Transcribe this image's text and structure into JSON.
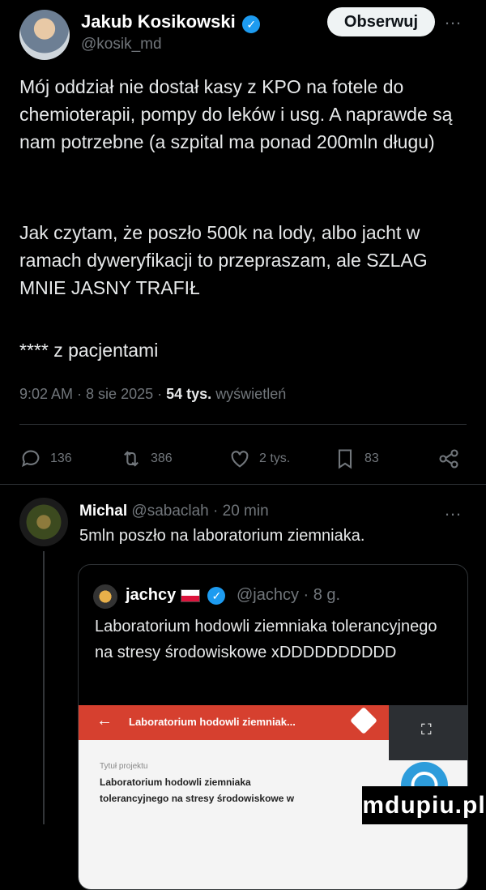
{
  "post": {
    "author_name": "Jakub Kosikowski",
    "author_handle": "@kosik_md",
    "follow_label": "Obserwuj",
    "more_icon": "…",
    "paragraphs": [
      "Mój oddział nie dostał kasy z KPO na fotele do chemioterapii, pompy do leków i usg. A naprawde są nam potrzebne (a szpital ma ponad 200mln długu)",
      "Jak czytam, że poszło 500k na lody, albo jacht w ramach dyweryfikacji to przepraszam, ale SZLAG MNIE JASNY TRAFIŁ",
      "**** z pacjentami"
    ],
    "time": "9:02 AM",
    "date": "8 sie 2025",
    "views_count": "54 tys.",
    "views_label": "wyświetleń"
  },
  "actions": {
    "replies": "136",
    "reposts": "386",
    "likes": "2 tys.",
    "bookmarks": "83"
  },
  "reply": {
    "author_name": "Michal",
    "author_handle": "@sabaclah",
    "age": "20 min",
    "text": "5mln poszło na laboratorium ziemniaka."
  },
  "quote": {
    "author_name": "jachcy",
    "author_handle": "@jachcy",
    "age": "8 g.",
    "text": "Laboratorium hodowli ziemniaka tolerancyjnego na stresy środowiskowe xDDDDDDDDDD",
    "image": {
      "header_title": "Laboratorium hodowli ziemniak...",
      "field_label": "Tytuł projektu",
      "field_value_line1": "Laboratorium hodowli ziemniaka",
      "field_value_line2": "tolerancyjnego na stresy środowiskowe w"
    }
  },
  "watermark": "mdupiu.pl",
  "colors": {
    "accent": "#1d9bf0",
    "background": "#000000",
    "text": "#e7e9ea",
    "muted": "#71767b"
  }
}
